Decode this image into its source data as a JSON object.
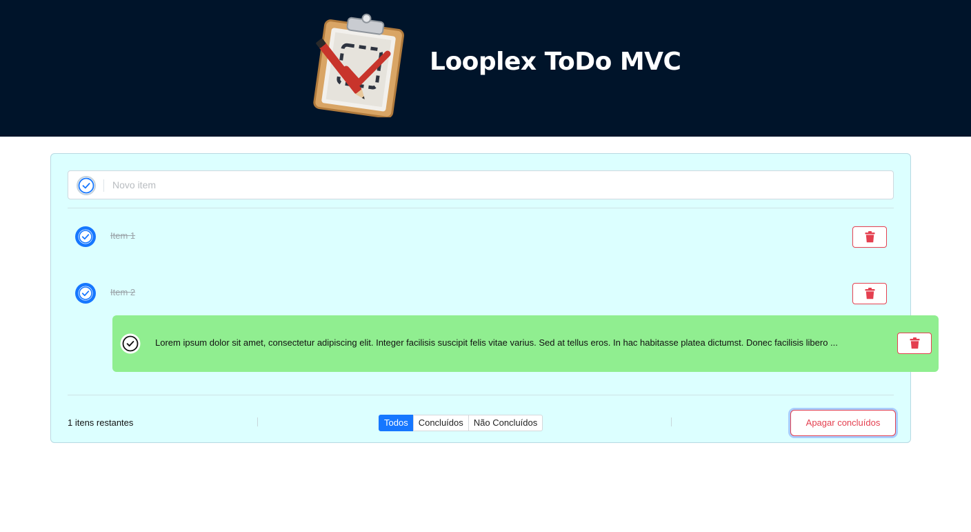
{
  "header": {
    "title": "Looplex ToDo MVC",
    "logo_icon": "clipboard-checklist-icon"
  },
  "new_item": {
    "placeholder": "Novo item",
    "toggle_icon": "check-circle-icon"
  },
  "todos": [
    {
      "label": "Item 1",
      "completed": true
    },
    {
      "label": "Item 2",
      "completed": true
    }
  ],
  "dragging_item": {
    "label": "Lorem ipsum dolor sit amet, consectetur adipiscing elit. Integer facilisis suscipit felis vitae varius. Sed at tellus eros. In hac habitasse platea dictumst. Donec facilisis libero ...",
    "background": "#90ee90"
  },
  "footer": {
    "count_text": "1 itens restantes",
    "filters": [
      "Todos",
      "Concluídos",
      "Não Concluídos"
    ],
    "active_filter": "Todos",
    "clear_label": "Apagar concluídos"
  },
  "colors": {
    "header_bg": "#00142a",
    "panel_bg": "#dcffff",
    "accent": "#1677ff",
    "danger": "#e43f4f"
  }
}
